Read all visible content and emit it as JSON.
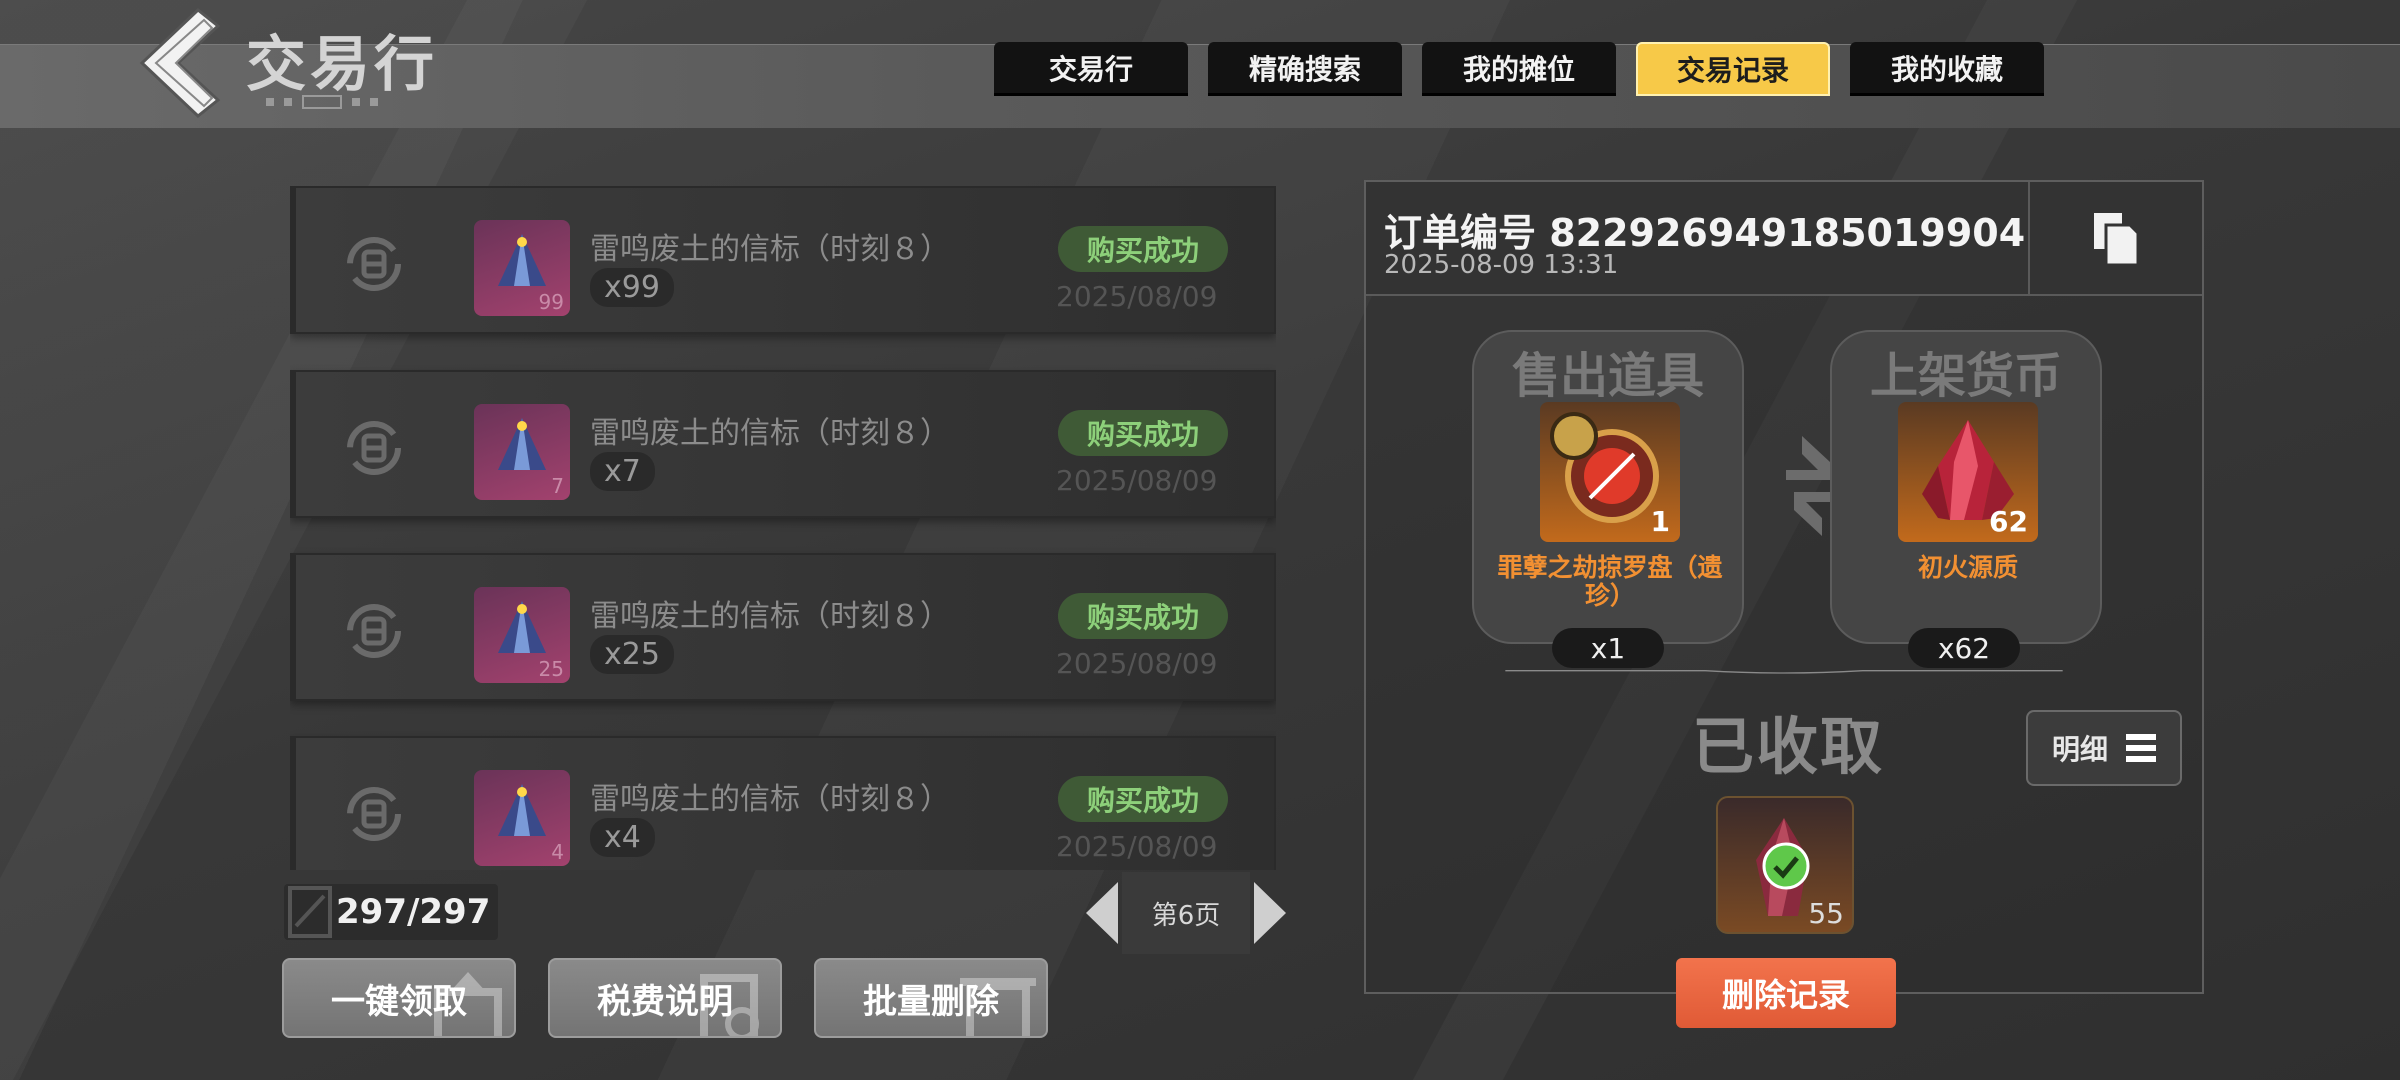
{
  "header": {
    "title": "交易行"
  },
  "tabs": [
    {
      "label": "交易行",
      "active": false
    },
    {
      "label": "精确搜索",
      "active": false
    },
    {
      "label": "我的摊位",
      "active": false
    },
    {
      "label": "交易记录",
      "active": true
    },
    {
      "label": "我的收藏",
      "active": false
    }
  ],
  "records": [
    {
      "name": "雷鸣废土的信标（时刻８）",
      "count": "x99",
      "badge_qty": "99",
      "status": "购买成功",
      "date": "2025/08/09"
    },
    {
      "name": "雷鸣废土的信标（时刻８）",
      "count": "x7",
      "badge_qty": "7",
      "status": "购买成功",
      "date": "2025/08/09"
    },
    {
      "name": "雷鸣废土的信标（时刻８）",
      "count": "x25",
      "badge_qty": "25",
      "status": "购买成功",
      "date": "2025/08/09"
    },
    {
      "name": "雷鸣废土的信标（时刻８）",
      "count": "x4",
      "badge_qty": "4",
      "status": "购买成功",
      "date": "2025/08/09"
    }
  ],
  "counter": "297/297",
  "pager": {
    "label": "第6页"
  },
  "buttons": {
    "claim_all": "一键领取",
    "tax_info": "税费说明",
    "batch_delete": "批量删除"
  },
  "detail": {
    "order_no": "订单编号 822926949185019904",
    "time": "2025-08-09 13:31",
    "sold": {
      "title": "售出道具",
      "qty": "1",
      "name": "罪孽之劫掠罗盘（遗珍）",
      "count": "x1"
    },
    "price": {
      "title": "上架货币",
      "qty": "62",
      "name": "初火源质",
      "count": "x62"
    },
    "collected_title": "已收取",
    "detail_label": "明细",
    "received_qty": "55",
    "delete_label": "删除记录"
  },
  "colors": {
    "accent_tab": "#f7c948",
    "success": "#8dd07a",
    "delete": "#e8643e",
    "item_name_orange": "#f29032"
  }
}
